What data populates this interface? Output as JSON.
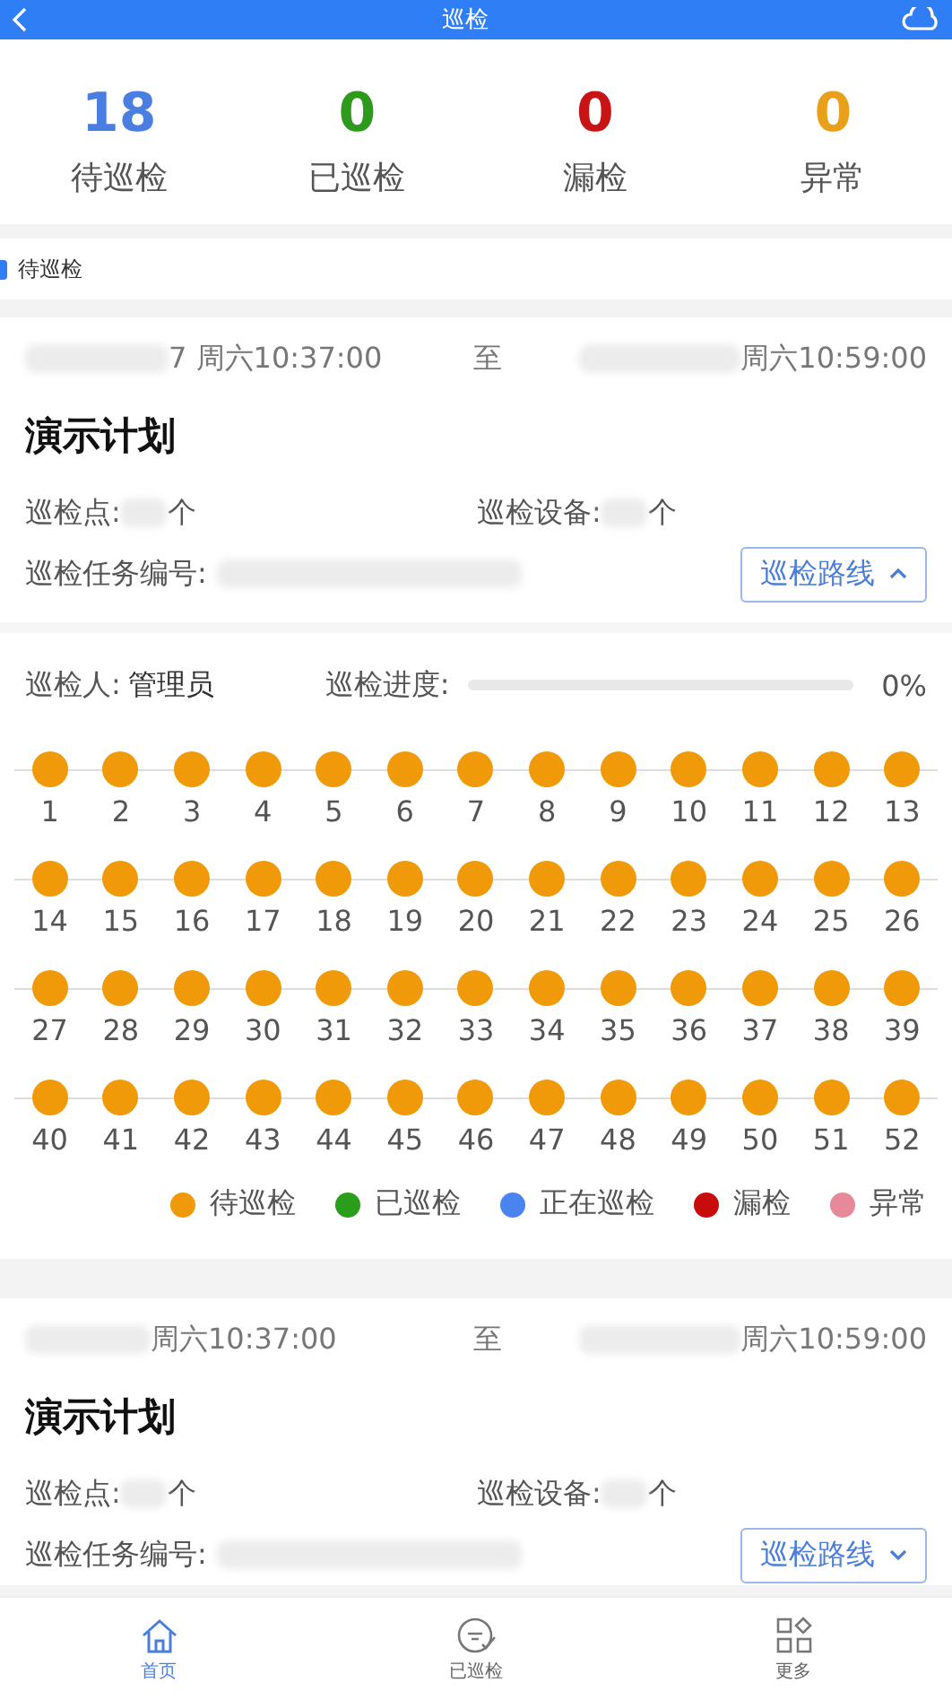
{
  "header": {
    "title": "巡检"
  },
  "stats": [
    {
      "value": "18",
      "label": "待巡检",
      "color": "#4a7ee0"
    },
    {
      "value": "0",
      "label": "已巡检",
      "color": "#2e9a1c"
    },
    {
      "value": "0",
      "label": "漏检",
      "color": "#c81414"
    },
    {
      "value": "0",
      "label": "异常",
      "color": "#e8a01a"
    }
  ],
  "section": {
    "title": "待巡检"
  },
  "cards": [
    {
      "start": "7 周六10:37:00",
      "to": "至",
      "end": "周六10:59:00",
      "title": "演示计划",
      "points_label": "巡检点:",
      "points_unit": "个",
      "devices_label": "巡检设备:",
      "devices_unit": "个",
      "task_label": "巡检任务编号:",
      "route_button": "巡检路线",
      "expanded": true,
      "inspector_label": "巡检人:",
      "inspector": "管理员",
      "progress_label": "巡检进度:",
      "progress": {
        "level": 0,
        "reading": "0%"
      },
      "points": [
        {
          "label": "1",
          "color": "#f09a0a"
        },
        {
          "label": "2",
          "color": "#f09a0a"
        },
        {
          "label": "3",
          "color": "#f09a0a"
        },
        {
          "label": "4",
          "color": "#f09a0a"
        },
        {
          "label": "5",
          "color": "#f09a0a"
        },
        {
          "label": "6",
          "color": "#f09a0a"
        },
        {
          "label": "7",
          "color": "#f09a0a"
        },
        {
          "label": "8",
          "color": "#f09a0a"
        },
        {
          "label": "9",
          "color": "#f09a0a"
        },
        {
          "label": "10",
          "color": "#f09a0a"
        },
        {
          "label": "11",
          "color": "#f09a0a"
        },
        {
          "label": "12",
          "color": "#f09a0a"
        },
        {
          "label": "13",
          "color": "#f09a0a"
        },
        {
          "label": "14",
          "color": "#f09a0a"
        },
        {
          "label": "15",
          "color": "#f09a0a"
        },
        {
          "label": "16",
          "color": "#f09a0a"
        },
        {
          "label": "17",
          "color": "#f09a0a"
        },
        {
          "label": "18",
          "color": "#f09a0a"
        },
        {
          "label": "19",
          "color": "#f09a0a"
        },
        {
          "label": "20",
          "color": "#f09a0a"
        },
        {
          "label": "21",
          "color": "#f09a0a"
        },
        {
          "label": "22",
          "color": "#f09a0a"
        },
        {
          "label": "23",
          "color": "#f09a0a"
        },
        {
          "label": "24",
          "color": "#f09a0a"
        },
        {
          "label": "25",
          "color": "#f09a0a"
        },
        {
          "label": "26",
          "color": "#f09a0a"
        },
        {
          "label": "27",
          "color": "#f09a0a"
        },
        {
          "label": "28",
          "color": "#f09a0a"
        },
        {
          "label": "29",
          "color": "#f09a0a"
        },
        {
          "label": "30",
          "color": "#f09a0a"
        },
        {
          "label": "31",
          "color": "#f09a0a"
        },
        {
          "label": "32",
          "color": "#f09a0a"
        },
        {
          "label": "33",
          "color": "#f09a0a"
        },
        {
          "label": "34",
          "color": "#f09a0a"
        },
        {
          "label": "35",
          "color": "#f09a0a"
        },
        {
          "label": "36",
          "color": "#f09a0a"
        },
        {
          "label": "37",
          "color": "#f09a0a"
        },
        {
          "label": "38",
          "color": "#f09a0a"
        },
        {
          "label": "39",
          "color": "#f09a0a"
        },
        {
          "label": "40",
          "color": "#f09a0a"
        },
        {
          "label": "41",
          "color": "#f09a0a"
        },
        {
          "label": "42",
          "color": "#f09a0a"
        },
        {
          "label": "43",
          "color": "#f09a0a"
        },
        {
          "label": "44",
          "color": "#f09a0a"
        },
        {
          "label": "45",
          "color": "#f09a0a"
        },
        {
          "label": "46",
          "color": "#f09a0a"
        },
        {
          "label": "47",
          "color": "#f09a0a"
        },
        {
          "label": "48",
          "color": "#f09a0a"
        },
        {
          "label": "49",
          "color": "#f09a0a"
        },
        {
          "label": "50",
          "color": "#f09a0a"
        },
        {
          "label": "51",
          "color": "#f09a0a"
        },
        {
          "label": "52",
          "color": "#f09a0a"
        }
      ],
      "legend": [
        {
          "label": "待巡检",
          "color": "#f09a0a"
        },
        {
          "label": "已巡检",
          "color": "#2a9e1c"
        },
        {
          "label": "正在巡检",
          "color": "#4a84f0"
        },
        {
          "label": "漏检",
          "color": "#c80c0c"
        },
        {
          "label": "异常",
          "color": "#e8899a"
        }
      ]
    },
    {
      "start": "周六10:37:00",
      "to": "至",
      "end": "周六10:59:00",
      "title": "演示计划",
      "points_label": "巡检点:",
      "points_unit": "个",
      "devices_label": "巡检设备:",
      "devices_unit": "个",
      "task_label": "巡检任务编号:",
      "route_button": "巡检路线",
      "expanded": false
    }
  ],
  "tabbar": [
    {
      "label": "首页",
      "selected": true
    },
    {
      "label": "已巡检",
      "selected": false
    },
    {
      "label": "更多",
      "selected": false
    }
  ]
}
